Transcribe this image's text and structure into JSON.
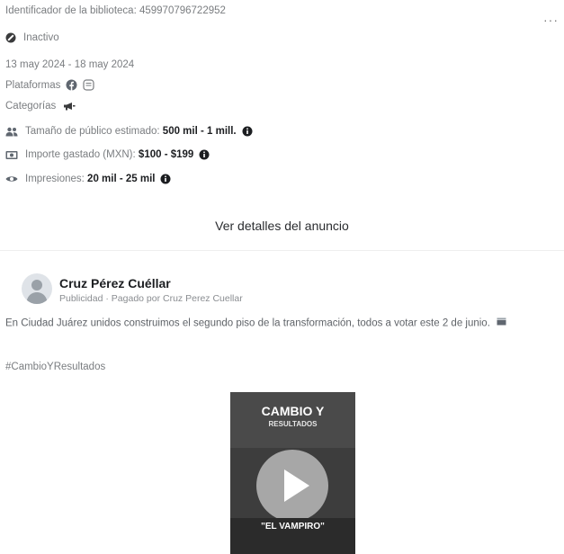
{
  "library": {
    "id_label": "Identificador de la biblioteca:",
    "id_value": "459970796722952",
    "status": "Inactivo",
    "dates": "13 may 2024 - 18 may 2024",
    "platforms_label": "Plataformas",
    "categories_label": "Categorías",
    "audience_label": "Tamaño de público estimado:",
    "audience_value": "500 mil - 1 mill.",
    "spend_label": "Importe gastado (MXN):",
    "spend_value": "$100 - $199",
    "impressions_label": "Impresiones:",
    "impressions_value": "20 mil - 25 mil",
    "more_icon": "more-options-icon"
  },
  "details_link": "Ver detalles del anuncio",
  "ad": {
    "advertiser": "Cruz Pérez Cuéllar",
    "sponsored": "Publicidad",
    "separator": "·",
    "paid_by_label": "Pagado por",
    "paid_by_name": "Cruz Perez Cuellar",
    "body": "En Ciudad Juárez unidos construimos el segundo piso de la transformación, todos a votar este 2 de junio.",
    "hashtag": "#CambioYResultados",
    "video": {
      "headline_1": "CAMBIO Y",
      "headline_2": "RESULTADOS",
      "label": "\"EL VAMPIRO\""
    }
  },
  "colors": {
    "text": "#5f6368",
    "strong": "#1c1e21",
    "facebook": "#606770"
  }
}
